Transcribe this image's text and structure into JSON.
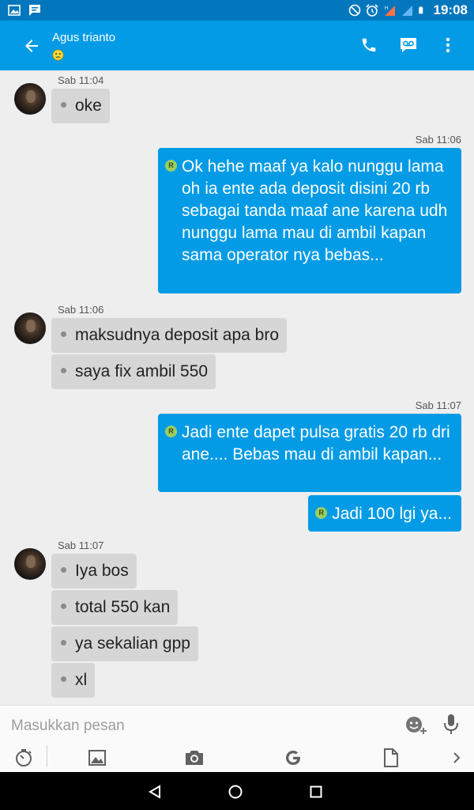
{
  "status_bar": {
    "time": "19:08",
    "left_icons": [
      "image-icon",
      "message-icon"
    ],
    "right_icons": [
      "do-not-disturb-icon",
      "alarm-icon",
      "signal-icon",
      "battery-icon"
    ],
    "network_label": "H"
  },
  "header": {
    "contact_name": "Agus trianto",
    "status_icon": "confused-face-icon",
    "actions": [
      "phone-icon",
      "video-message-icon",
      "more-vert-icon"
    ]
  },
  "messages": [
    {
      "timestamp": "Sab 11:04",
      "direction": "incoming",
      "bubbles": [
        "oke"
      ]
    },
    {
      "timestamp": "Sab 11:06",
      "direction": "outgoing",
      "bubbles": [
        "Ok hehe maaf ya kalo nunggu lama oh ia ente ada deposit disini 20 rb sebagai tanda maaf ane karena udh nunggu lama mau di ambil kapan sama operator nya bebas..."
      ]
    },
    {
      "timestamp": "Sab 11:06",
      "direction": "incoming",
      "bubbles": [
        "maksudnya deposit apa bro",
        "saya fix ambil 550"
      ]
    },
    {
      "timestamp": "Sab 11:07",
      "direction": "outgoing",
      "bubbles": [
        "Jadi ente dapet pulsa gratis 20 rb dri ane....  Bebas mau di ambil kapan...",
        "Jadi 100 lgi ya..."
      ]
    },
    {
      "timestamp": "Sab 11:07",
      "direction": "incoming",
      "bubbles": [
        "Iya bos",
        "total 550 kan",
        "ya sekalian gpp",
        "xl"
      ]
    }
  ],
  "composer": {
    "placeholder": "Masukkan pesan",
    "value": "",
    "toolbar_icons": [
      "timer-icon",
      "gallery-icon",
      "camera-icon",
      "google-icon",
      "document-icon",
      "chevron-right-icon"
    ]
  },
  "colors": {
    "status_bar": "#0277bd",
    "app_bar": "#039be5",
    "outgoing_bubble": "#039be5",
    "incoming_bubble": "#d6d6d6",
    "background": "#eeeeee"
  }
}
